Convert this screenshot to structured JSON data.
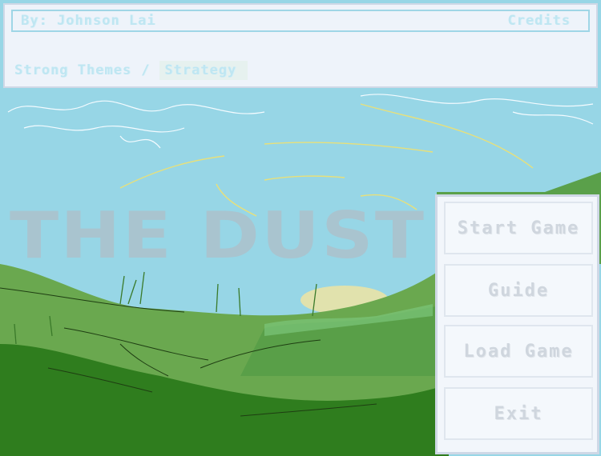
{
  "header": {
    "author": "By: Johnson Lai",
    "credits": "Credits",
    "genre_primary": "Strong Themes",
    "genre_separator": "/",
    "genre_secondary": "Strategy"
  },
  "title": "THE DUST",
  "menu": {
    "start": "Start Game",
    "guide": "Guide",
    "load": "Load Game",
    "exit": "Exit"
  },
  "colors": {
    "sky": "#97d6e6",
    "grass_light": "#6aa84f",
    "grass_dark": "#2f7d1e",
    "title_gray": "#a9c4cf"
  }
}
